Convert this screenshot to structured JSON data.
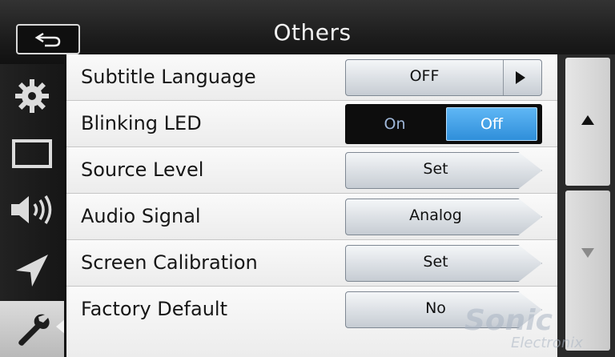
{
  "header": {
    "title": "Others"
  },
  "sidebar": {
    "items": [
      {
        "icon": "gear-icon"
      },
      {
        "icon": "display-icon"
      },
      {
        "icon": "speaker-icon"
      },
      {
        "icon": "navigation-icon"
      },
      {
        "icon": "wrench-icon",
        "active": true
      }
    ]
  },
  "settings": {
    "rows": [
      {
        "label": "Subtitle Language",
        "value": "OFF"
      },
      {
        "label": "Blinking LED",
        "on": "On",
        "off": "Off",
        "selected": "Off"
      },
      {
        "label": "Source Level",
        "value": "Set"
      },
      {
        "label": "Audio Signal",
        "value": "Analog"
      },
      {
        "label": "Screen Calibration",
        "value": "Set"
      },
      {
        "label": "Factory Default",
        "value": "No"
      }
    ]
  },
  "watermark": {
    "brand": "Sonic",
    "sub": "Electronix"
  },
  "colors": {
    "accent": "#3a9be6",
    "header": "#1c1c1c",
    "list_bg": "#f4f4f4"
  }
}
